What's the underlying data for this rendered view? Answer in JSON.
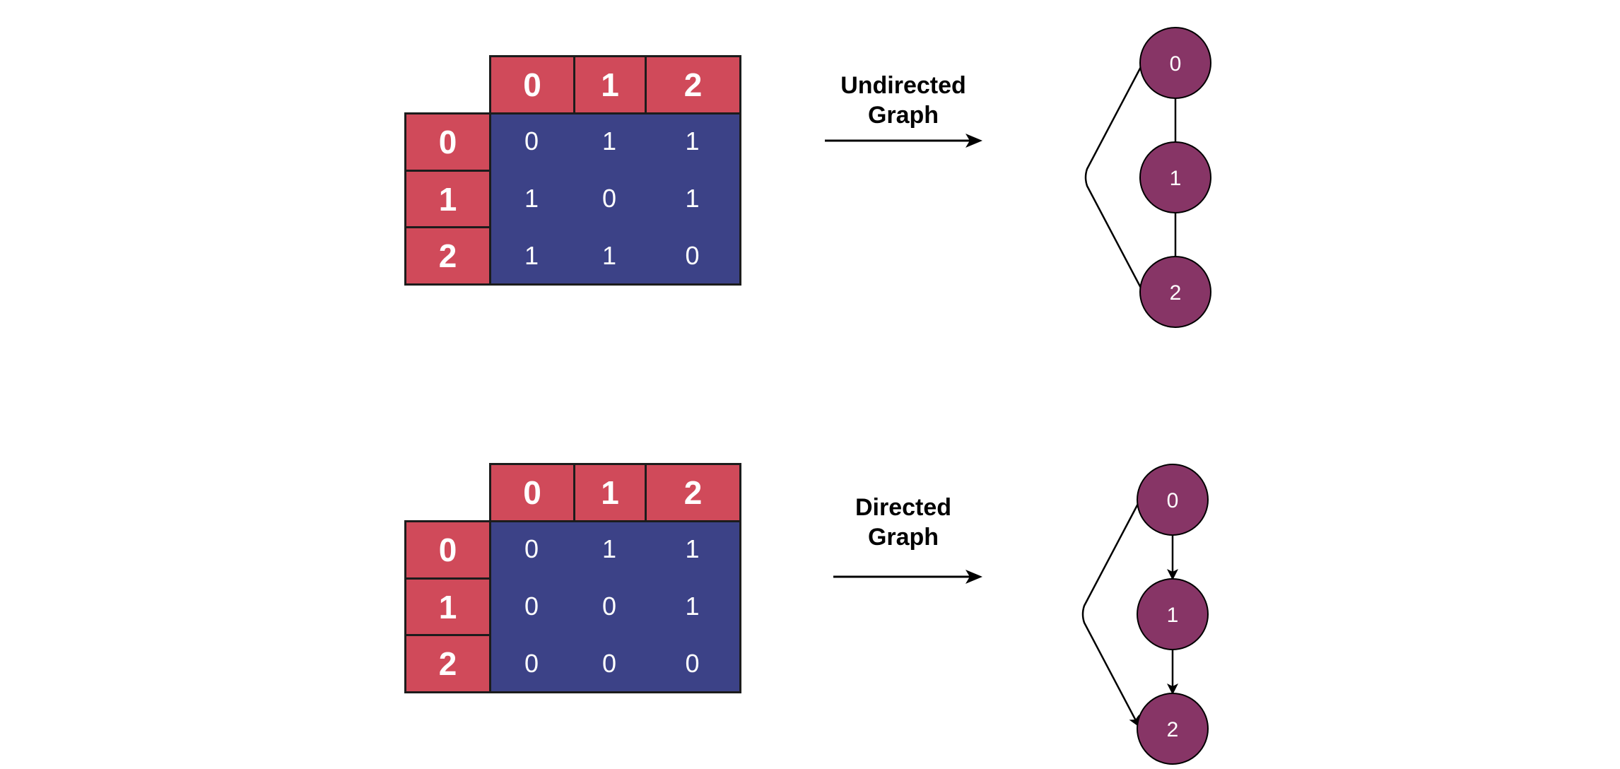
{
  "colors": {
    "header_fill": "#d04a5a",
    "matrix_fill": "#3c4287",
    "node_fill": "#873566",
    "border": "#1c1c1c",
    "text_light": "#ffffff"
  },
  "diagrams": [
    {
      "label_line1": "Undirected",
      "label_line2": "Graph",
      "col_headers": [
        "0",
        "1",
        "2"
      ],
      "row_headers": [
        "0",
        "1",
        "2"
      ],
      "matrix": [
        [
          "0",
          "1",
          "1"
        ],
        [
          "1",
          "0",
          "1"
        ],
        [
          "1",
          "1",
          "0"
        ]
      ],
      "graph": {
        "directed": false,
        "nodes": [
          "0",
          "1",
          "2"
        ],
        "edges": [
          [
            "0",
            "1"
          ],
          [
            "1",
            "2"
          ],
          [
            "0",
            "2"
          ]
        ]
      }
    },
    {
      "label_line1": "Directed",
      "label_line2": "Graph",
      "col_headers": [
        "0",
        "1",
        "2"
      ],
      "row_headers": [
        "0",
        "1",
        "2"
      ],
      "matrix": [
        [
          "0",
          "1",
          "1"
        ],
        [
          "0",
          "0",
          "1"
        ],
        [
          "0",
          "0",
          "0"
        ]
      ],
      "graph": {
        "directed": true,
        "nodes": [
          "0",
          "1",
          "2"
        ],
        "edges": [
          [
            "0",
            "1"
          ],
          [
            "1",
            "2"
          ],
          [
            "0",
            "2"
          ]
        ]
      }
    }
  ]
}
